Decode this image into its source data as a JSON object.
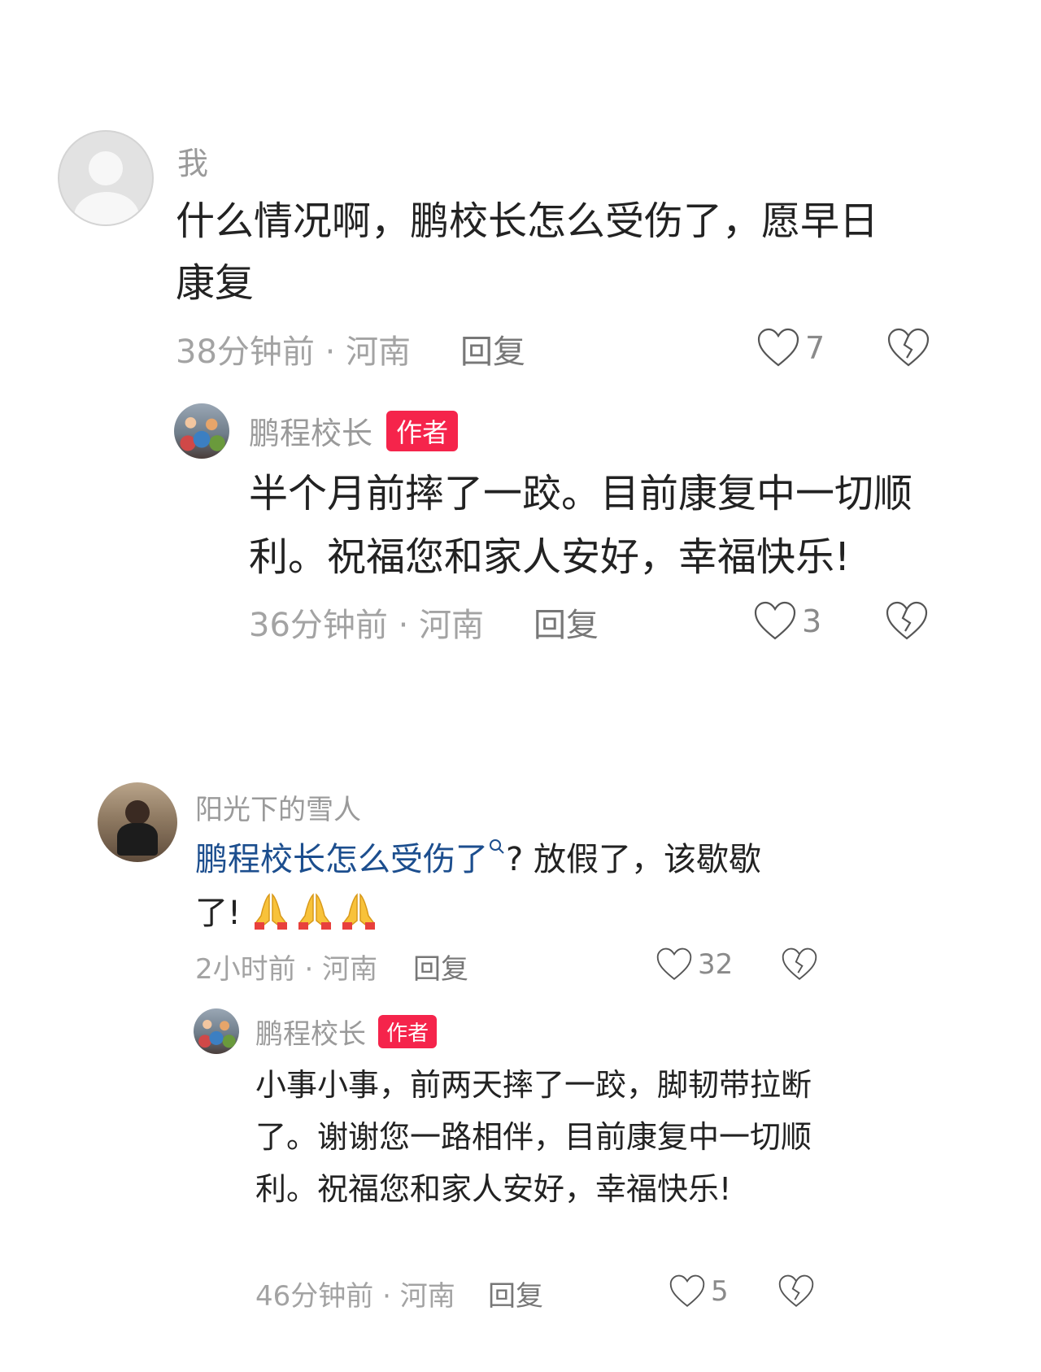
{
  "comments": [
    {
      "username": "我",
      "text": "什么情况啊，鹏校长怎么受伤了，愿早日康复",
      "time": "38分钟前",
      "location": "河南",
      "reply_label": "回复",
      "likes": "7",
      "replies": [
        {
          "username": "鹏程校长",
          "badge": "作者",
          "text": "半个月前摔了一跤。目前康复中一切顺利。祝福您和家人安好，幸福快乐!",
          "time": "36分钟前",
          "location": "河南",
          "reply_label": "回复",
          "likes": "3"
        }
      ]
    },
    {
      "username": "阳光下的雪人",
      "link_text": "鹏程校长怎么受伤了",
      "text_after": "? 放假了，该歇歇了!",
      "emojis": [
        "folded-hands",
        "folded-hands",
        "folded-hands"
      ],
      "time": "2小时前",
      "location": "河南",
      "reply_label": "回复",
      "likes": "32",
      "replies": [
        {
          "username": "鹏程校长",
          "badge": "作者",
          "text": "小事小事，前两天摔了一跤，脚韧带拉断了。谢谢您一路相伴，目前康复中一切顺利。祝福您和家人安好，幸福快乐!",
          "time": "46分钟前",
          "location": "河南",
          "reply_label": "回复",
          "likes": "5"
        }
      ]
    }
  ],
  "separator": " · ",
  "colors": {
    "badge": "#f5244b",
    "link": "#1c4e8e",
    "meta": "#a3a3a3"
  },
  "icons": {
    "like": "heart-outline-icon",
    "dislike": "broken-heart-icon",
    "search": "search-icon"
  }
}
